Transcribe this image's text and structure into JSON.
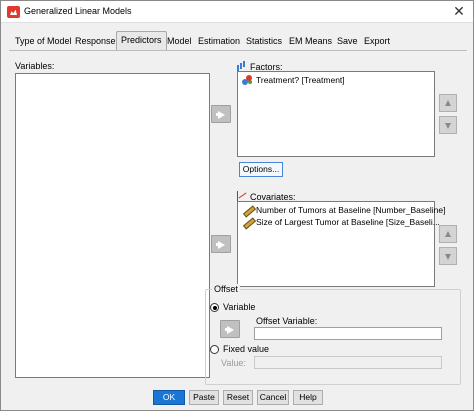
{
  "window": {
    "title": "Generalized Linear Models",
    "close_glyph": "✕"
  },
  "tabs": [
    {
      "label": "Type of Model",
      "active": false
    },
    {
      "label": "Response",
      "active": false
    },
    {
      "label": "Predictors",
      "active": true
    },
    {
      "label": "Model",
      "active": false
    },
    {
      "label": "Estimation",
      "active": false
    },
    {
      "label": "Statistics",
      "active": false
    },
    {
      "label": "EM Means",
      "active": false
    },
    {
      "label": "Save",
      "active": false
    },
    {
      "label": "Export",
      "active": false
    }
  ],
  "variables": {
    "label": "Variables:",
    "items": []
  },
  "factors": {
    "label": "Factors:",
    "items": [
      {
        "label": "Treatment? [Treatment]",
        "icon": "nominal-icon"
      }
    ],
    "options_button": "Options..."
  },
  "covariates": {
    "label": "Covariates:",
    "items": [
      {
        "label": "Number of Tumors at Baseline [Number_Baseline]",
        "icon": "scale-icon"
      },
      {
        "label": "Size of Largest Tumor at Baseline [Size_Baseli...",
        "icon": "scale-icon"
      }
    ]
  },
  "offset": {
    "group_label": "Offset",
    "variable_radio": "Variable",
    "variable_selected": true,
    "offset_variable_label": "Offset Variable:",
    "offset_variable_value": "",
    "fixed_radio": "Fixed value",
    "fixed_selected": false,
    "value_label": "Value:",
    "value_value": ""
  },
  "buttons": {
    "ok": "OK",
    "paste": "Paste",
    "reset": "Reset",
    "cancel": "Cancel",
    "help": "Help"
  },
  "colors": {
    "accent": "#1a75d4",
    "arrow_button": "#c0c0c0"
  }
}
